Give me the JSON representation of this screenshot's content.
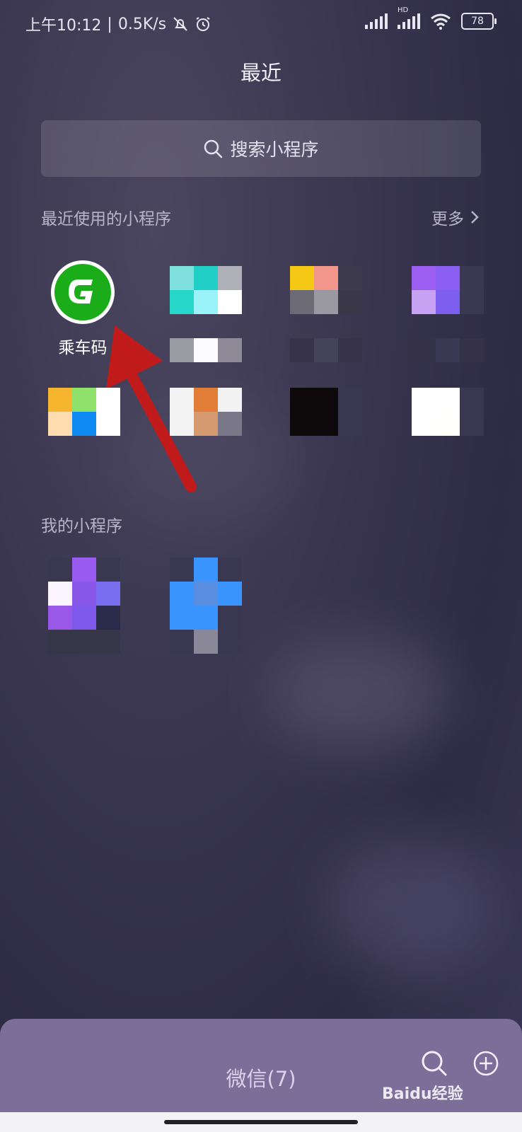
{
  "status_bar": {
    "time": "上午10:12",
    "network_speed": "0.5K/s",
    "separator": "|",
    "battery_level": "78",
    "hd_label": "HD"
  },
  "page": {
    "title": "最近"
  },
  "search": {
    "label": "搜索小程序",
    "icon": "search-icon"
  },
  "recent": {
    "label": "最近使用的小程序",
    "more_label": "更多",
    "apps": [
      {
        "name": "乘车码",
        "icon": "ride-code-logo"
      }
    ]
  },
  "mine": {
    "label": "我的小程序"
  },
  "bottom_bar": {
    "title": "微信(7)"
  },
  "watermark": {
    "text": "Baidu经验"
  },
  "colors": {
    "accent_green": "#1aad19",
    "arrow_red": "#c01a1a",
    "bottom_bar": "#7b6f9a"
  }
}
